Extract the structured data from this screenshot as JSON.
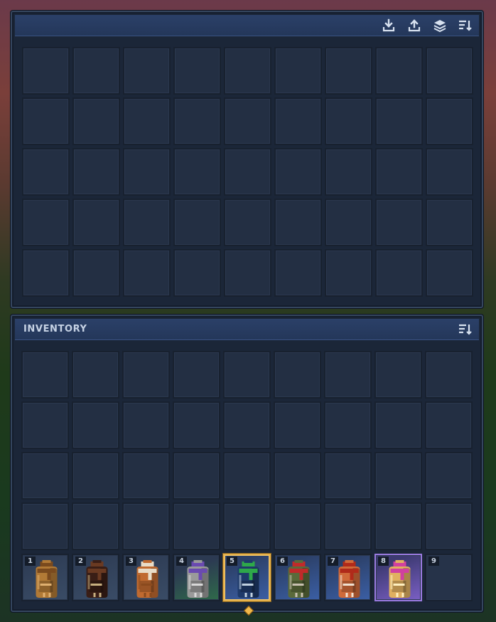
{
  "container": {
    "title": "",
    "actions": [
      {
        "name": "deposit-icon",
        "label": "Deposit"
      },
      {
        "name": "take-all-icon",
        "label": "Take all"
      },
      {
        "name": "stack-icon",
        "label": "Quick stack"
      },
      {
        "name": "sort-icon",
        "label": "Sort"
      }
    ],
    "rows": 5,
    "cols": 9
  },
  "inventory": {
    "title": "INVENTORY",
    "rows": 4,
    "cols": 9
  },
  "hotbar": {
    "selected": 5,
    "slots": [
      {
        "number": "1",
        "item": "leather-backpack-brown",
        "rarity": "common",
        "colors": {
          "body": "#b27a36",
          "trim": "#7a4a1e",
          "accent": "#e0b070"
        }
      },
      {
        "number": "2",
        "item": "dark-leather-backpack",
        "rarity": "common",
        "colors": {
          "body": "#3a1e16",
          "trim": "#6a3a22",
          "accent": "#c8b080"
        }
      },
      {
        "number": "3",
        "item": "orange-backpack-white-strap",
        "rarity": "common",
        "colors": {
          "body": "#c06a30",
          "trim": "#e8dcc8",
          "accent": "#8a4a1e"
        }
      },
      {
        "number": "4",
        "item": "gray-backpack-purple-scarf",
        "rarity": "uncommon",
        "colors": {
          "body": "#9a9a9a",
          "trim": "#6a4ab0",
          "accent": "#d8d8d8"
        }
      },
      {
        "number": "5",
        "item": "blue-backpack-green-scarf",
        "rarity": "rare",
        "colors": {
          "body": "#1e3a6a",
          "trim": "#2ea84a",
          "accent": "#c0d0e0"
        }
      },
      {
        "number": "6",
        "item": "camo-backpack-red-scarf",
        "rarity": "rare",
        "colors": {
          "body": "#5a6a3a",
          "trim": "#c02a2a",
          "accent": "#c8c0b0"
        }
      },
      {
        "number": "7",
        "item": "orange-backpack-red-trim",
        "rarity": "rare",
        "colors": {
          "body": "#d06a3a",
          "trim": "#b02a1a",
          "accent": "#f0e0d0"
        }
      },
      {
        "number": "8",
        "item": "gold-backpack-pink-scarf",
        "rarity": "epic",
        "colors": {
          "body": "#e0b060",
          "trim": "#d040a0",
          "accent": "#fff0c0"
        }
      },
      {
        "number": "9",
        "item": "",
        "rarity": "empty",
        "colors": {}
      }
    ]
  }
}
